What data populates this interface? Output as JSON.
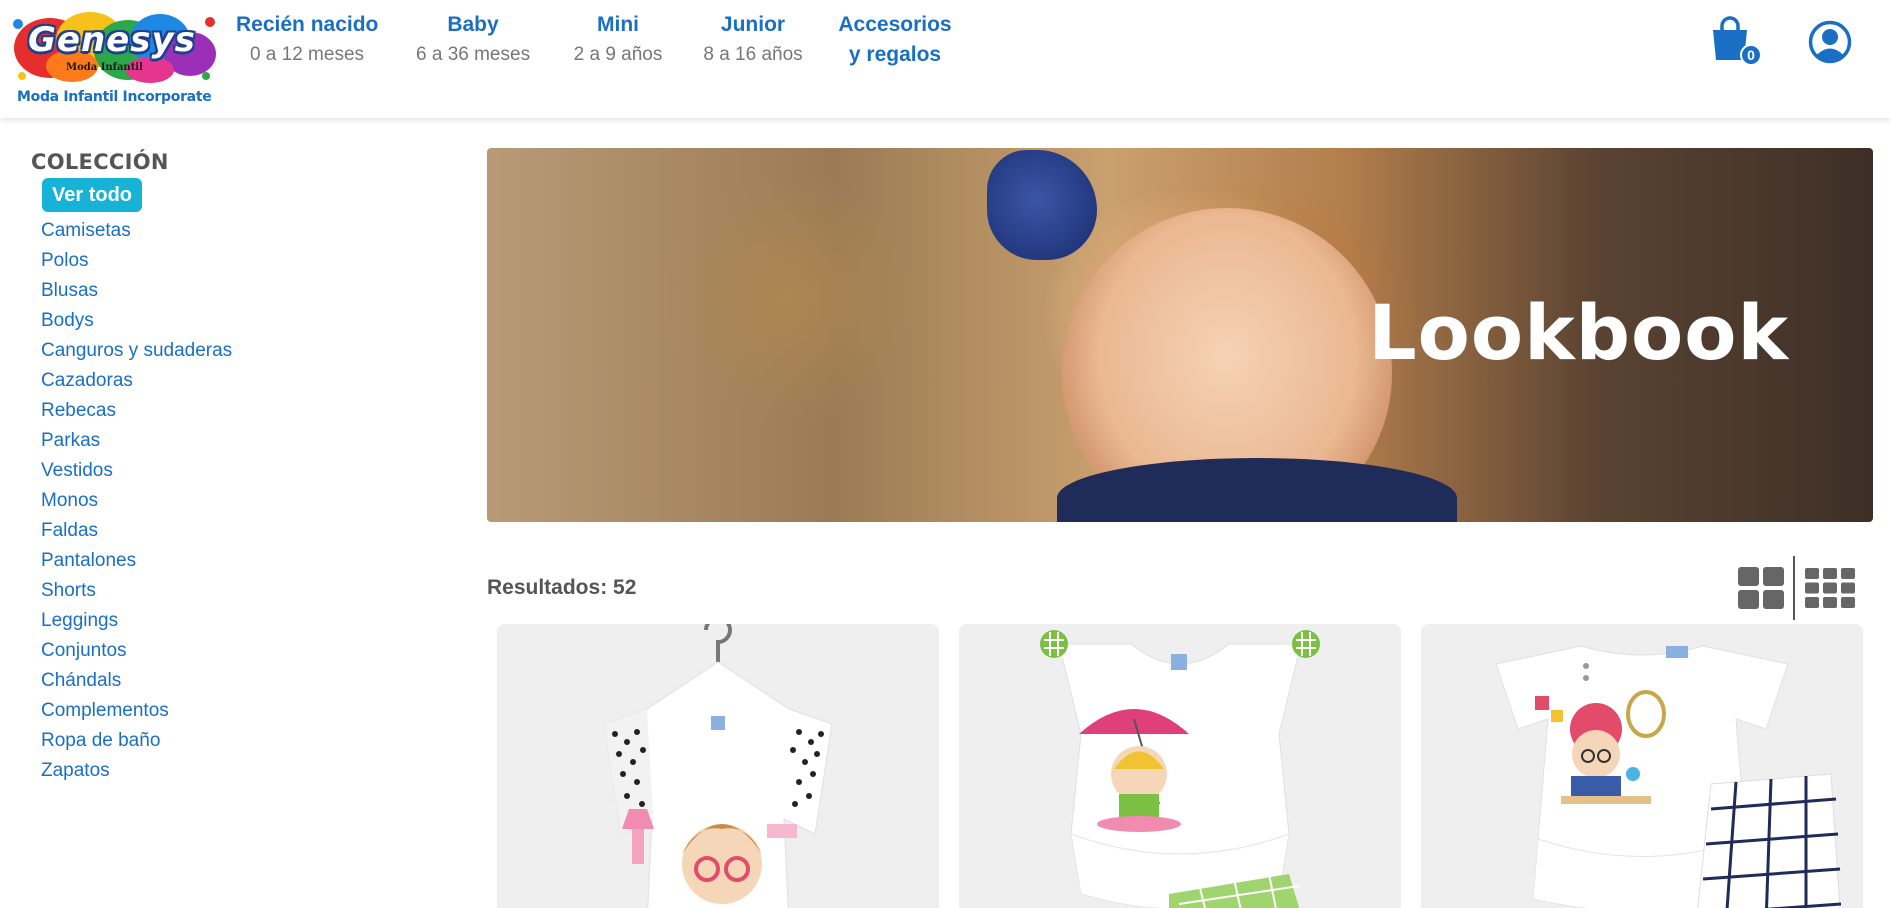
{
  "header": {
    "logo": {
      "brand": "Genesys",
      "subtitle": "Moda Infantil",
      "tagline": "Moda Infantil Incorporate"
    },
    "nav": [
      {
        "title": "Recién nacido",
        "subtitle": "0 a 12 meses"
      },
      {
        "title": "Baby",
        "subtitle": "6 a 36 meses"
      },
      {
        "title": "Mini",
        "subtitle": "2 a 9 años"
      },
      {
        "title": "Junior",
        "subtitle": "8 a 16 años"
      },
      {
        "title": "Accesorios",
        "subtitle": "y regalos"
      }
    ],
    "cart_count": "0",
    "cart_icon": "shopping-bag-icon",
    "user_icon": "user-circle-icon"
  },
  "sidebar": {
    "title": "COLECCIÓN",
    "active": "Ver todo",
    "items": [
      "Camisetas",
      "Polos",
      "Blusas",
      "Bodys",
      "Canguros y sudaderas",
      "Cazadoras",
      "Rebecas",
      "Parkas",
      "Vestidos",
      "Monos",
      "Faldas",
      "Pantalones",
      "Shorts",
      "Leggings",
      "Conjuntos",
      "Chándals",
      "Complementos",
      "Ropa de baño",
      "Zapatos"
    ]
  },
  "banner": {
    "title": "Lookbook"
  },
  "results": {
    "label": "Resultados: 52"
  },
  "view_toggles": [
    {
      "icon": "grid-2x2-icon"
    },
    {
      "icon": "grid-3x3-icon"
    }
  ],
  "colors": {
    "primary": "#1a6fc4",
    "active_bg": "#17b3d6",
    "muted_text": "#777777",
    "heading_text": "#555555",
    "card_bg": "#efefef",
    "grid_icon": "#666666"
  }
}
